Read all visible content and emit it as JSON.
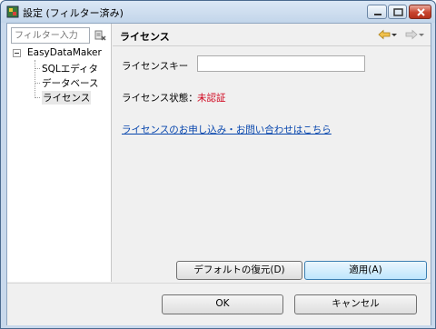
{
  "window": {
    "title": "設定 (フィルター済み)"
  },
  "sidebar": {
    "filter_placeholder": "フィルター入力",
    "tree": {
      "root": "EasyDataMaker",
      "items": [
        {
          "label": "SQLエディタ"
        },
        {
          "label": "データベース"
        },
        {
          "label": "ライセンス",
          "selected": true
        }
      ]
    }
  },
  "page": {
    "title": "ライセンス",
    "license_key_label": "ライセンスキー",
    "license_key_value": "",
    "status_label": "ライセンス状態：",
    "status_value": "未認証",
    "status_color": "#d0021b",
    "link_text": "ライセンスのお申し込み・お問い合わせはこちら",
    "restore_defaults_label": "デフォルトの復元(D)",
    "apply_label": "適用(A)"
  },
  "footer": {
    "ok_label": "OK",
    "cancel_label": "キャンセル"
  },
  "icons": {
    "app": "app-icon",
    "filter_clear": "clear-filter-icon",
    "back": "back-arrow-icon",
    "forward": "forward-arrow-icon"
  }
}
